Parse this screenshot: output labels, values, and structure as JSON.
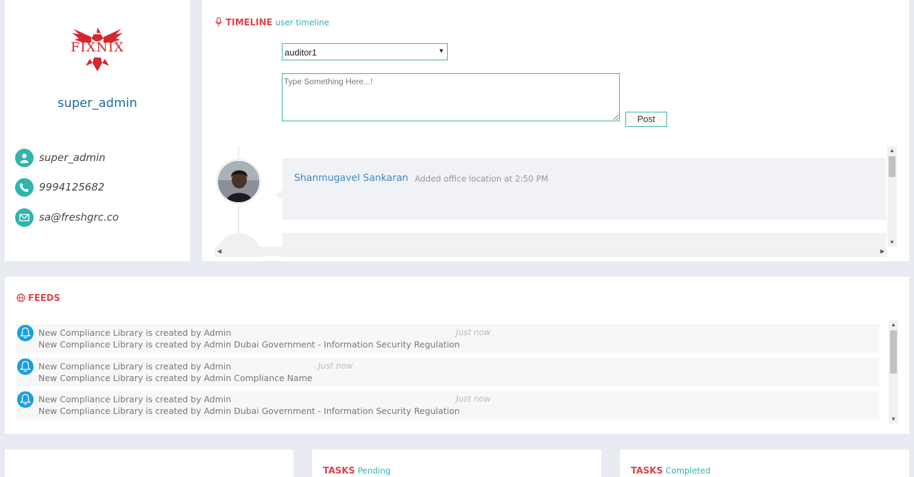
{
  "profile": {
    "logo_text": "FIXNIX",
    "name": "super_admin",
    "username": "super_admin",
    "phone": "9994125682",
    "email": "sa@freshgrc.co",
    "icons": [
      "user-icon",
      "phone-icon",
      "envelope-icon"
    ],
    "accent_color": "#2fb4ae"
  },
  "timeline": {
    "title": "TIMELINE",
    "subtitle": "user timeline",
    "icon": "microphone-icon",
    "select_value": "auditor1",
    "textarea_placeholder": "Type Something Here...!",
    "post_label": "Post",
    "entries": [
      {
        "author": "Shanmugavel Sankaran",
        "action": "Added office location at 2:50 PM"
      }
    ]
  },
  "feeds": {
    "title": "FEEDS",
    "icon": "globe-icon",
    "items": [
      {
        "title": "New Compliance Library is created by Admin",
        "time": "Just now",
        "desc": "New Compliance Library is created by Admin Dubai Government - Information Security Regulation"
      },
      {
        "title": "New Compliance Library is created by Admin",
        "time": "Just now",
        "desc": "New Compliance Library is created by Admin Compliance Name"
      },
      {
        "title": "New Compliance Library is created by Admin",
        "time": "Just now",
        "desc": "New Compliance Library is created by Admin Dubai Government - Information Security Regulation"
      }
    ]
  },
  "bottom": {
    "tasks_pending_title": "TASKS",
    "tasks_pending_sub": "Pending",
    "tasks_completed_title": "TASKS",
    "tasks_completed_sub": "Completed"
  },
  "colors": {
    "title_red": "#e0434b",
    "teal": "#2fb4ae",
    "link_blue": "#3d8ac4",
    "bell_blue": "#1a9fe0"
  }
}
